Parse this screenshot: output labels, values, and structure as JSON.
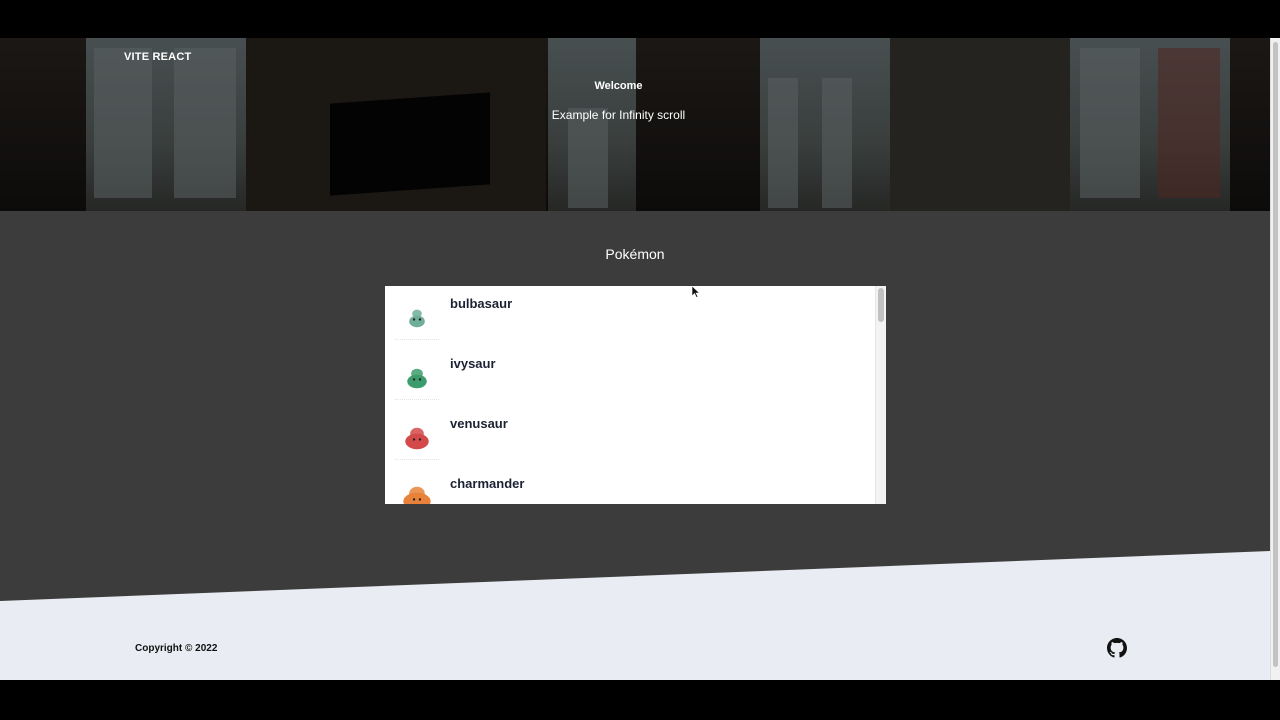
{
  "header": {
    "brand": "VITE REACT"
  },
  "hero": {
    "title": "Welcome",
    "subtitle": "Example for Infinity scroll"
  },
  "section": {
    "title": "Pokémon"
  },
  "pokemon": [
    {
      "name": "bulbasaur",
      "color": "#6fae9b"
    },
    {
      "name": "ivysaur",
      "color": "#3d9c6c"
    },
    {
      "name": "venusaur",
      "color": "#d44a4a"
    },
    {
      "name": "charmander",
      "color": "#e8823a"
    }
  ],
  "footer": {
    "copyright": "Copyright © 2022",
    "icon": "github-icon"
  },
  "colors": {
    "section_bg": "#3c3c3c",
    "footer_bg": "#e9ecf2",
    "card_bg": "#ffffff"
  }
}
